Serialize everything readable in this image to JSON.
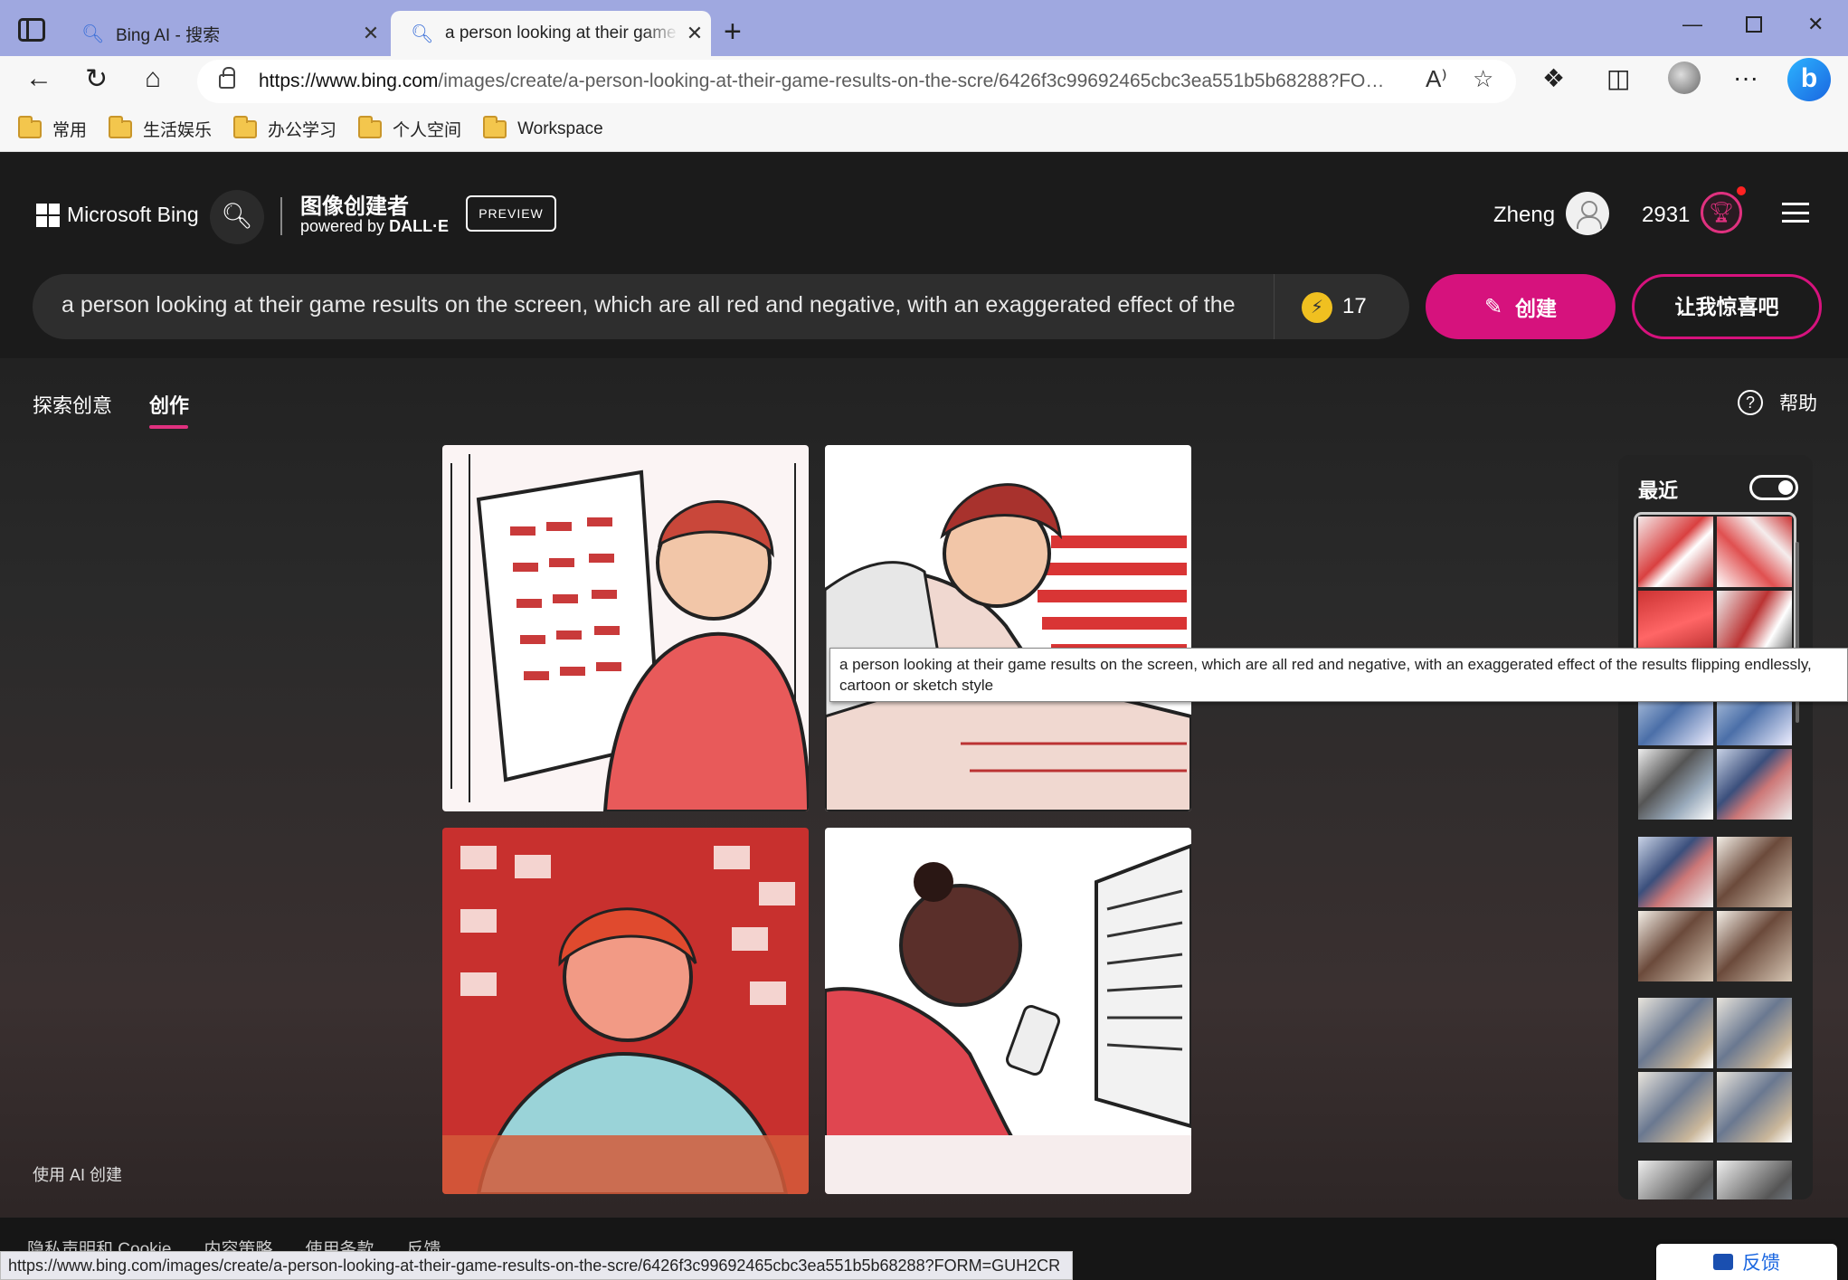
{
  "browser": {
    "tabs": [
      {
        "label": "Bing AI - 搜索",
        "icon": "search-icon"
      },
      {
        "label": "a person looking at their game re",
        "icon": "search-icon"
      }
    ],
    "url_host": "https://www.bing.com",
    "url_path": "/images/create/a-person-looking-at-their-game-results-on-the-scre/6426f3c99692465cbc3ea551b5b68288?FOR...",
    "favorites": [
      "常用",
      "生活娱乐",
      "办公学习",
      "个人空间",
      "Workspace"
    ]
  },
  "header": {
    "logo_text": "Microsoft Bing",
    "product_title": "图像创建者",
    "powered_by": "powered by",
    "engine": "DALL·E",
    "preview_badge": "PREVIEW",
    "username": "Zheng",
    "points": "2931"
  },
  "prompt": {
    "text": "a person looking at their game results on the screen, which are all red and negative, with an exaggerated effect of the results flipping endlessly",
    "boost_count": "17",
    "create_label": "创建",
    "surprise_label": "让我惊喜吧"
  },
  "nav": {
    "explore_label": "探索创意",
    "create_label": "创作",
    "help_label": "帮助"
  },
  "recent": {
    "title": "最近"
  },
  "footer": {
    "ai_note": "使用 AI 创建",
    "links": [
      "隐私声明和 Cookie",
      "内容策略",
      "使用条款",
      "反馈"
    ]
  },
  "tooltip": {
    "line1": "a person looking at their game results on the screen, which are all red and negative, with an exaggerated effect of the results flipping endlessly,",
    "line2": "cartoon or sketch style"
  },
  "status_url": "https://www.bing.com/images/create/a-person-looking-at-their-game-results-on-the-scre/6426f3c99692465cbc3ea551b5b68288?FORM=GUH2CR",
  "feedback_label": "反馈",
  "colors": {
    "accent": "#d6127d",
    "tabbar": "#9fa8e0"
  }
}
